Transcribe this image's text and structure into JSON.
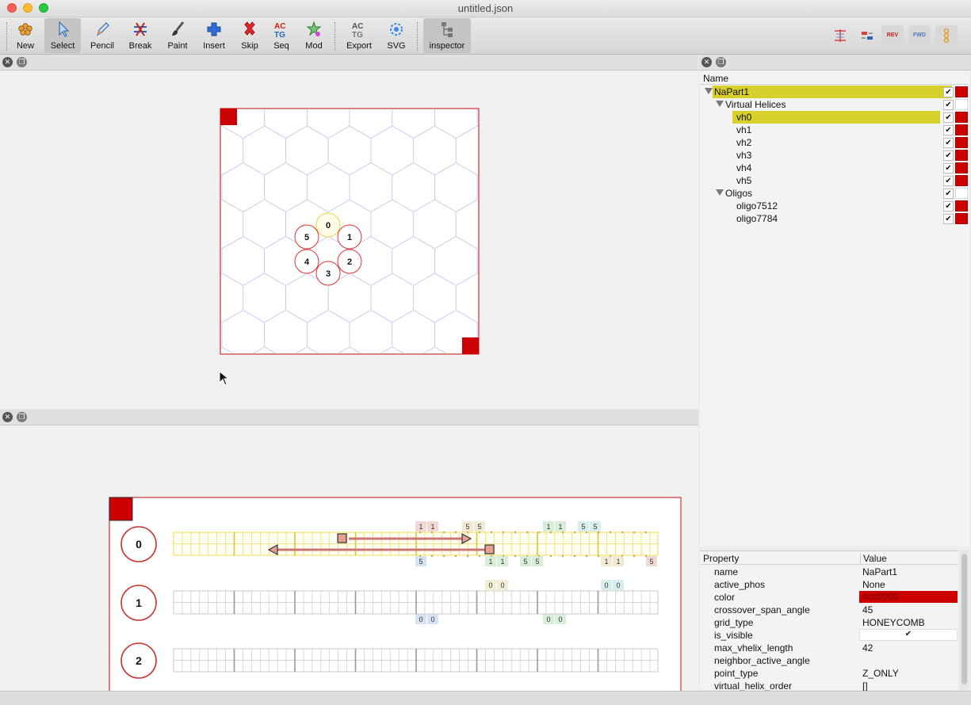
{
  "window": {
    "title": "untitled.json"
  },
  "toolbar": {
    "buttons": [
      {
        "label": "New",
        "icon": "new-icon"
      },
      {
        "label": "Select",
        "icon": "select-cursor-icon"
      },
      {
        "label": "Pencil",
        "icon": "pencil-icon"
      },
      {
        "label": "Break",
        "icon": "break-icon"
      },
      {
        "label": "Paint",
        "icon": "paint-brush-icon"
      },
      {
        "label": "Insert",
        "icon": "insert-plus-icon"
      },
      {
        "label": "Skip",
        "icon": "skip-x-icon"
      },
      {
        "label": "Seq",
        "icon": "sequence-icon"
      },
      {
        "label": "Mod",
        "icon": "mod-icon"
      },
      {
        "label": "Export",
        "icon": "export-icon"
      },
      {
        "label": "SVG",
        "icon": "svg-icon"
      },
      {
        "label": "inspector",
        "icon": "inspector-icon"
      }
    ],
    "right_buttons": [
      {
        "label": "",
        "icon": "slice-icon"
      },
      {
        "label": "",
        "icon": "swap-icon"
      },
      {
        "label": "REV",
        "icon": "rev-icon"
      },
      {
        "label": "FWD",
        "icon": "fwd-icon"
      },
      {
        "label": "",
        "icon": "list-icon"
      }
    ]
  },
  "slice_view": {
    "helices": [
      {
        "label": "0"
      },
      {
        "label": "1"
      },
      {
        "label": "2"
      },
      {
        "label": "3"
      },
      {
        "label": "4"
      },
      {
        "label": "5"
      }
    ]
  },
  "path_view": {
    "helices": [
      {
        "label": "0"
      },
      {
        "label": "1"
      },
      {
        "label": "2"
      }
    ],
    "helix0_top_labels": [
      "1",
      "1",
      "5",
      "5",
      "1",
      "1",
      "5",
      "5"
    ],
    "helix0_bottom_labels": [
      "5",
      "1",
      "1",
      "5",
      "5",
      "1",
      "1",
      "5"
    ],
    "helix1_top_labels": [
      "0",
      "0",
      "0",
      "0"
    ],
    "helix1_bottom_labels": [
      "0",
      "0",
      "0",
      "0"
    ]
  },
  "tree": {
    "header": "Name",
    "items": [
      {
        "label": "NaPart1",
        "checked": "✔",
        "color": "#cc0000"
      },
      {
        "label": "Virtual Helices",
        "checked": "✔"
      },
      {
        "label": "vh0",
        "checked": "✔",
        "color": "#cc0000"
      },
      {
        "label": "vh1",
        "checked": "✔",
        "color": "#cc0000"
      },
      {
        "label": "vh2",
        "checked": "✔",
        "color": "#cc0000"
      },
      {
        "label": "vh3",
        "checked": "✔",
        "color": "#cc0000"
      },
      {
        "label": "vh4",
        "checked": "✔",
        "color": "#cc0000"
      },
      {
        "label": "vh5",
        "checked": "✔",
        "color": "#cc0000"
      },
      {
        "label": "Oligos",
        "checked": "✔"
      },
      {
        "label": "oligo7512",
        "checked": "✔",
        "color": "#cc0000"
      },
      {
        "label": "oligo7784",
        "checked": "✔",
        "color": "#cc0000"
      }
    ]
  },
  "properties": {
    "header_property": "Property",
    "header_value": "Value",
    "rows": [
      {
        "key": "name",
        "value": "NaPart1"
      },
      {
        "key": "active_phos",
        "value": "None"
      },
      {
        "key": "color",
        "value": "#cc0000"
      },
      {
        "key": "crossover_span_angle",
        "value": "45"
      },
      {
        "key": "grid_type",
        "value": "HONEYCOMB"
      },
      {
        "key": "is_visible",
        "value": "✔"
      },
      {
        "key": "max_vhelix_length",
        "value": "42"
      },
      {
        "key": "neighbor_active_angle",
        "value": ""
      },
      {
        "key": "point_type",
        "value": "Z_ONLY"
      },
      {
        "key": "virtual_helix_order",
        "value": "[]"
      }
    ]
  },
  "colors": {
    "part": "#cc0000",
    "selection": "#d6cf2c"
  }
}
